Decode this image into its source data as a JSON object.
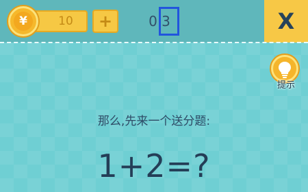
{
  "header": {
    "coin_icon_glyph": "¥",
    "coin_count": "10",
    "add_coins_glyph": "+",
    "level_number": "0.3",
    "close_glyph": "X"
  },
  "hint": {
    "icon": "lightbulb-icon",
    "label": "提示"
  },
  "question": {
    "intro": "那么,先来一个送分题:",
    "text": "1+2=?"
  },
  "colors": {
    "background": "#6fcfd3",
    "topbar": "#5fb7bb",
    "coin_gold": "#f6c844",
    "close_yellow": "#f7c846",
    "highlight_blue": "#2255dd",
    "text_dark": "#243e57"
  }
}
